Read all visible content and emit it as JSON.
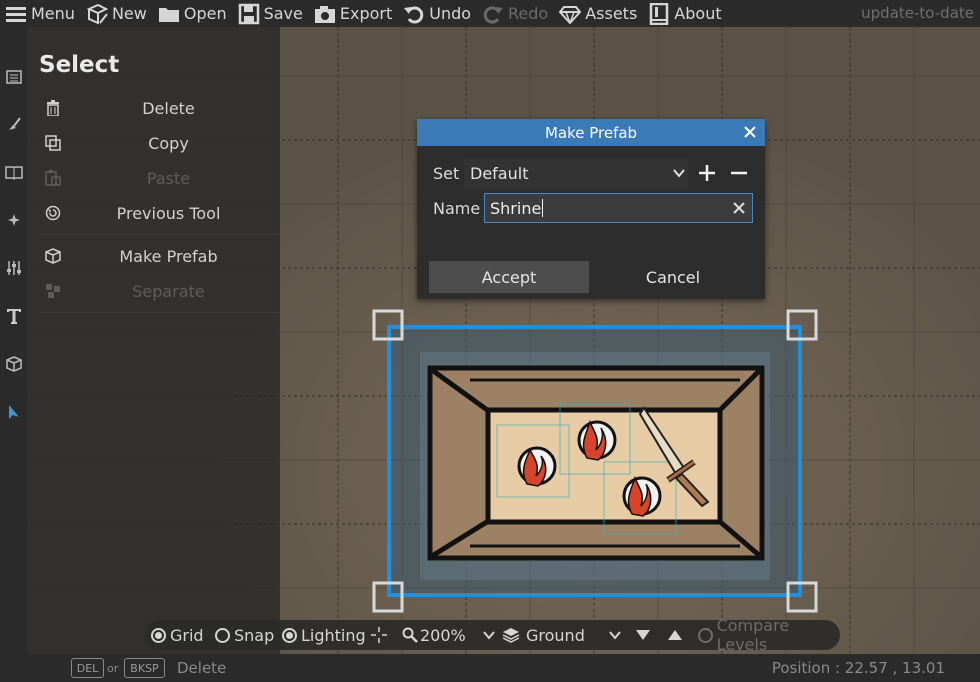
{
  "menu": {
    "items": [
      {
        "label": "Menu",
        "icon": "hamburger-icon"
      },
      {
        "label": "New",
        "icon": "new-map-icon"
      },
      {
        "label": "Open",
        "icon": "folder-icon"
      },
      {
        "label": "Save",
        "icon": "floppy-icon"
      },
      {
        "label": "Export",
        "icon": "camera-icon"
      },
      {
        "label": "Undo",
        "icon": "undo-icon"
      },
      {
        "label": "Redo",
        "icon": "redo-icon",
        "disabled": true
      },
      {
        "label": "Assets",
        "icon": "gem-icon"
      },
      {
        "label": "About",
        "icon": "book-icon"
      }
    ],
    "status": "update-to-date"
  },
  "tools": [
    "trace-icon",
    "terrain-brush-icon",
    "materials-book-icon",
    "effects-sparkle-icon",
    "sliders-icon",
    "text-tool-icon",
    "prefab-box-icon",
    "select-arrow-icon"
  ],
  "panel": {
    "title": "Select",
    "items": [
      {
        "label": "Delete",
        "icon": "trash-icon",
        "disabled": false
      },
      {
        "label": "Copy",
        "icon": "copy-icon",
        "disabled": false
      },
      {
        "label": "Paste",
        "icon": "paste-icon",
        "disabled": true
      },
      {
        "label": "Previous Tool",
        "icon": "previous-tool-icon",
        "disabled": false
      },
      {
        "label": "Make Prefab",
        "icon": "prefab-icon",
        "disabled": false
      },
      {
        "label": "Separate",
        "icon": "separate-icon",
        "disabled": true
      }
    ]
  },
  "dialog": {
    "title": "Make Prefab",
    "set_label": "Set",
    "set_value": "Default",
    "name_label": "Name",
    "name_value": "Shrine",
    "accept_label": "Accept",
    "cancel_label": "Cancel"
  },
  "bottombar": {
    "grid": {
      "label": "Grid",
      "checked": true
    },
    "snap": {
      "label": "Snap",
      "checked": false
    },
    "lighting": {
      "label": "Lighting",
      "checked": true
    },
    "zoom": "200%",
    "layer": "Ground",
    "compare_levels": {
      "label": "Compare Levels",
      "checked": false,
      "disabled": true
    }
  },
  "status": {
    "key1": "DEL",
    "or": "or",
    "key2": "BKSP",
    "hint": "Delete",
    "position": "Position : 22.57 , 13.01"
  },
  "colors": {
    "accent": "#3a7ab6",
    "selection": "#1f8fe0",
    "flame": "#d6452a"
  }
}
